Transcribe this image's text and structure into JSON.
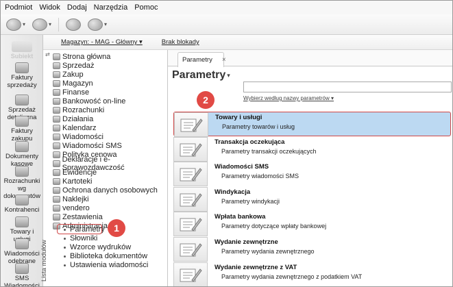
{
  "menubar": [
    "Podmiot",
    "Widok",
    "Dodaj",
    "Narzędzia",
    "Pomoc"
  ],
  "logo": "Subiekt",
  "modules": [
    {
      "label": "Faktury sprzedaży"
    },
    {
      "label": "Sprzedaż detaliczna"
    },
    {
      "label": "Faktury zakupu"
    },
    {
      "label": "Dokumenty kasowe"
    },
    {
      "label": "Rozrachunki wg dokumentów"
    },
    {
      "label": "Kontrahenci"
    },
    {
      "label": "Towary i usługi"
    },
    {
      "label": "Wiadomości odebrane"
    },
    {
      "label": "SMS Wiadomości"
    }
  ],
  "side_label": "Lista modułów",
  "infobar": {
    "warehouse": "Magazyn: - MAG - Główny ▾",
    "lock": "Brak blokady"
  },
  "tree": {
    "items": [
      "Strona główna",
      "Sprzedaż",
      "Zakup",
      "Magazyn",
      "Finanse",
      "Bankowość on-line",
      "Rozrachunki",
      "Działania",
      "Kalendarz",
      "Wiadomości",
      "Wiadomości SMS",
      "Polityka cenowa",
      "Deklaracje i e-Sprawozdawczość",
      "Ewidencje",
      "Kartoteki",
      "Ochrona danych osobowych",
      "Naklejki",
      "vendero",
      "Zestawienia",
      "Administracja"
    ],
    "sub_items": [
      "Parametry",
      "Słowniki",
      "Wzorce wydruków",
      "Biblioteka dokumentów",
      "Ustawienia wiadomości"
    ]
  },
  "callouts": {
    "one": "1",
    "two": "2"
  },
  "tab": {
    "label": "Parametry",
    "close": "×"
  },
  "page_title": "Parametry",
  "search": {
    "filter_label": "Wybierz według nazwy parametrów ▾"
  },
  "params": [
    {
      "title": "Towary i usługi",
      "subtitle": "Parametry towarów i usług",
      "selected": true
    },
    {
      "title": "Transakcja oczekująca",
      "subtitle": "Parametry transakcji oczekujących"
    },
    {
      "title": "Wiadomości SMS",
      "subtitle": "Parametry wiadomości SMS"
    },
    {
      "title": "Windykacja",
      "subtitle": "Parametry windykacji"
    },
    {
      "title": "Wpłata bankowa",
      "subtitle": "Parametry dotyczące wpłaty bankowej"
    },
    {
      "title": "Wydanie zewnętrzne",
      "subtitle": "Parametry wydania zewnętrznego"
    },
    {
      "title": "Wydanie zewnętrzne z VAT",
      "subtitle": "Parametry wydania zewnętrznego z podatkiem VAT"
    }
  ],
  "colors": {
    "selection": "#bcd9f2",
    "callout": "#e14a45",
    "highlight_border": "#d04646"
  }
}
